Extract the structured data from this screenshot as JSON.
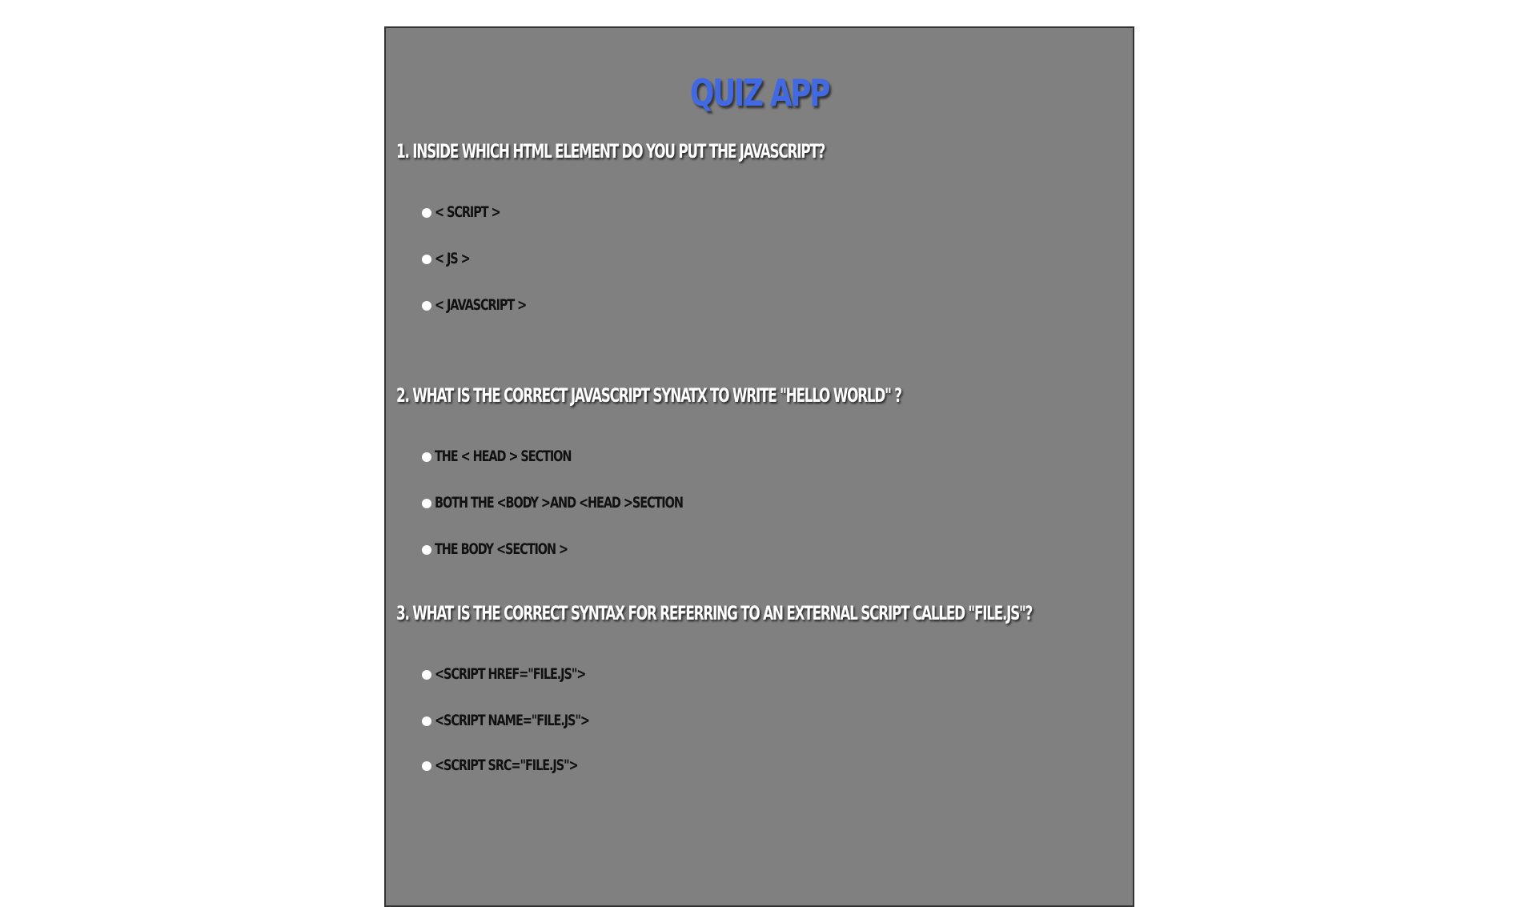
{
  "app": {
    "title": "QUIZ APP",
    "accent_color": "#4169e1",
    "panel_color": "#808080"
  },
  "questions": [
    {
      "text": "1. INSIDE WHICH HTML ELEMENT DO YOU PUT THE JAVASCRIPT?",
      "options": [
        "< SCRIPT >",
        "< JS >",
        "< JAVASCRIPT >"
      ]
    },
    {
      "text": "2. WHAT IS THE CORRECT JAVASCRIPT SYNATX TO WRITE \"HELLO WORLD\" ?",
      "options": [
        " THE < HEAD > SECTION",
        "BOTH THE <BODY >AND <HEAD >SECTION",
        "THE BODY <SECTION >"
      ]
    },
    {
      "text": "3. WHAT IS THE CORRECT SYNTAX FOR REFERRING TO AN EXTERNAL SCRIPT CALLED \"FILE.JS\"?",
      "options": [
        "<SCRIPT HREF=\"FILE.JS\">",
        "<SCRIPT NAME=\"FILE.JS\">",
        " <SCRIPT SRC=\"FILE.JS\">"
      ]
    }
  ]
}
